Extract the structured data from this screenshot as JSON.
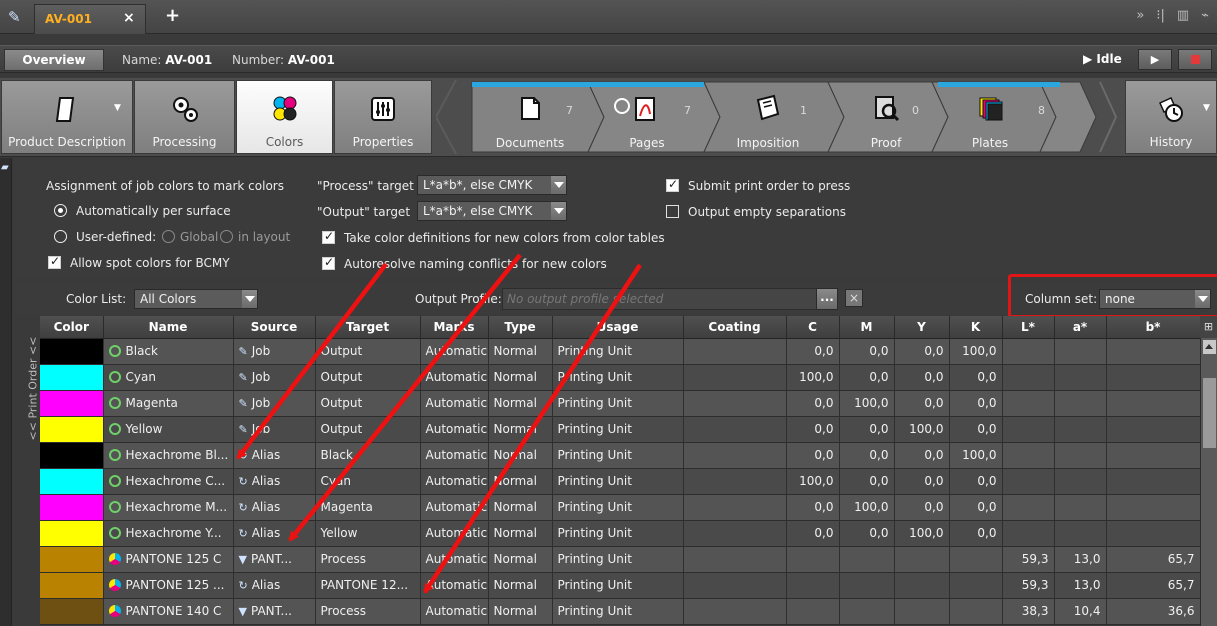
{
  "tabbar": {
    "doc_tab": "AV-001",
    "close": "×",
    "add": "+",
    "more": "»"
  },
  "infobar": {
    "overview": "Overview",
    "name_label": "Name:",
    "name_value": "AV-001",
    "number_label": "Number:",
    "number_value": "AV-001",
    "status": "Idle"
  },
  "toolbar": {
    "product_description": "Product Description",
    "processing": "Processing",
    "colors": "Colors",
    "properties": "Properties",
    "documents": "Documents",
    "documents_count": "7",
    "pages": "Pages",
    "pages_count": "7",
    "imposition": "Imposition",
    "imposition_count": "1",
    "proof": "Proof",
    "proof_count": "0",
    "plates": "Plates",
    "plates_count": "8",
    "history": "History"
  },
  "options": {
    "assignment_title": "Assignment of job colors to mark colors",
    "auto_per_surface": "Automatically per surface",
    "user_defined": "User-defined:",
    "global": "Global",
    "in_layout": "in layout",
    "allow_spot": "Allow spot colors for BCMY",
    "process_target_label": "\"Process\" target",
    "process_target_value": "L*a*b*, else CMYK",
    "output_target_label": "\"Output\" target",
    "output_target_value": "L*a*b*, else CMYK",
    "take_color_defs": "Take color definitions for new colors from color tables",
    "autoresolve": "Autoresolve naming conflicts for new colors",
    "submit_print_order": "Submit print order to press",
    "output_empty_seps": "Output empty separations"
  },
  "listbar": {
    "color_list_label": "Color List:",
    "color_list_value": "All Colors",
    "output_profile_label": "Output Profile:",
    "output_profile_placeholder": "No output profile selected",
    "ellipsis": "...",
    "clear": "×",
    "column_set_label": "Column set:",
    "column_set_value": "none"
  },
  "table": {
    "vertical_label": "<< Print Order <<",
    "columns": [
      "Color",
      "Name",
      "Source",
      "Target",
      "Marks",
      "Type",
      "Usage",
      "Coating",
      "C",
      "M",
      "Y",
      "K",
      "L*",
      "a*",
      "b*"
    ],
    "rows": [
      {
        "swatch": "#000000",
        "dot": "green",
        "name": "Black",
        "source": "Job",
        "source_icon": "job-icon",
        "target": "Output",
        "marks": "Automatic",
        "type": "Normal",
        "usage": "Printing Unit",
        "coating": "",
        "c": "0,0",
        "m": "0,0",
        "y": "0,0",
        "k": "100,0",
        "l": "",
        "a": "",
        "b": ""
      },
      {
        "swatch": "#00ffff",
        "dot": "green",
        "name": "Cyan",
        "source": "Job",
        "source_icon": "job-icon",
        "target": "Output",
        "marks": "Automatic",
        "type": "Normal",
        "usage": "Printing Unit",
        "coating": "",
        "c": "100,0",
        "m": "0,0",
        "y": "0,0",
        "k": "0,0",
        "l": "",
        "a": "",
        "b": ""
      },
      {
        "swatch": "#ff00ff",
        "dot": "green",
        "name": "Magenta",
        "source": "Job",
        "source_icon": "job-icon",
        "target": "Output",
        "marks": "Automatic",
        "type": "Normal",
        "usage": "Printing Unit",
        "coating": "",
        "c": "0,0",
        "m": "100,0",
        "y": "0,0",
        "k": "0,0",
        "l": "",
        "a": "",
        "b": ""
      },
      {
        "swatch": "#ffff00",
        "dot": "green",
        "name": "Yellow",
        "source": "Job",
        "source_icon": "job-icon",
        "target": "Output",
        "marks": "Automatic",
        "type": "Normal",
        "usage": "Printing Unit",
        "coating": "",
        "c": "0,0",
        "m": "0,0",
        "y": "100,0",
        "k": "0,0",
        "l": "",
        "a": "",
        "b": ""
      },
      {
        "swatch": "#000000",
        "dot": "green",
        "name": "Hexachrome Bl...",
        "source": "Alias",
        "source_icon": "alias-icon",
        "target": "Black",
        "marks": "Automatic",
        "type": "Normal",
        "usage": "Printing Unit",
        "coating": "",
        "c": "0,0",
        "m": "0,0",
        "y": "0,0",
        "k": "100,0",
        "l": "",
        "a": "",
        "b": ""
      },
      {
        "swatch": "#00ffff",
        "dot": "green",
        "name": "Hexachrome C...",
        "source": "Alias",
        "source_icon": "alias-icon",
        "target": "Cyan",
        "marks": "Automatic",
        "type": "Normal",
        "usage": "Printing Unit",
        "coating": "",
        "c": "100,0",
        "m": "0,0",
        "y": "0,0",
        "k": "0,0",
        "l": "",
        "a": "",
        "b": ""
      },
      {
        "swatch": "#ff00ff",
        "dot": "green",
        "name": "Hexachrome M...",
        "source": "Alias",
        "source_icon": "alias-icon",
        "target": "Magenta",
        "marks": "Automatic",
        "type": "Normal",
        "usage": "Printing Unit",
        "coating": "",
        "c": "0,0",
        "m": "100,0",
        "y": "0,0",
        "k": "0,0",
        "l": "",
        "a": "",
        "b": ""
      },
      {
        "swatch": "#ffff00",
        "dot": "green",
        "name": "Hexachrome Y...",
        "source": "Alias",
        "source_icon": "alias-icon",
        "target": "Yellow",
        "marks": "Automatic",
        "type": "Normal",
        "usage": "Printing Unit",
        "coating": "",
        "c": "0,0",
        "m": "0,0",
        "y": "100,0",
        "k": "0,0",
        "l": "",
        "a": "",
        "b": ""
      },
      {
        "swatch": "#b98200",
        "dot": "pantone",
        "name": "PANTONE 125 C",
        "source": "PANT...",
        "source_icon": "pantone-table-icon",
        "target": "Process",
        "marks": "Automatic",
        "type": "Normal",
        "usage": "Printing Unit",
        "coating": "",
        "c": "",
        "m": "",
        "y": "",
        "k": "",
        "l": "59,3",
        "a": "13,0",
        "b": "65,7"
      },
      {
        "swatch": "#b98200",
        "dot": "pantone",
        "name": "PANTONE 125 ...",
        "source": "Alias",
        "source_icon": "alias-icon",
        "target": "PANTONE 12...",
        "marks": "Automatic",
        "type": "Normal",
        "usage": "Printing Unit",
        "coating": "",
        "c": "",
        "m": "",
        "y": "",
        "k": "",
        "l": "59,3",
        "a": "13,0",
        "b": "65,7"
      },
      {
        "swatch": "#6e5012",
        "dot": "pantone",
        "name": "PANTONE 140 C",
        "source": "PANT...",
        "source_icon": "pantone-table-icon",
        "target": "Process",
        "marks": "Automatic",
        "type": "Normal",
        "usage": "Printing Unit",
        "coating": "",
        "c": "",
        "m": "",
        "y": "",
        "k": "",
        "l": "38,3",
        "a": "10,4",
        "b": "36,6"
      }
    ]
  },
  "colors": {
    "accent_orange": "#ffb020",
    "workflow_strip": "#2aa7df",
    "highlight_box": "#e01515",
    "annotation_arrow": "#ee1111"
  }
}
